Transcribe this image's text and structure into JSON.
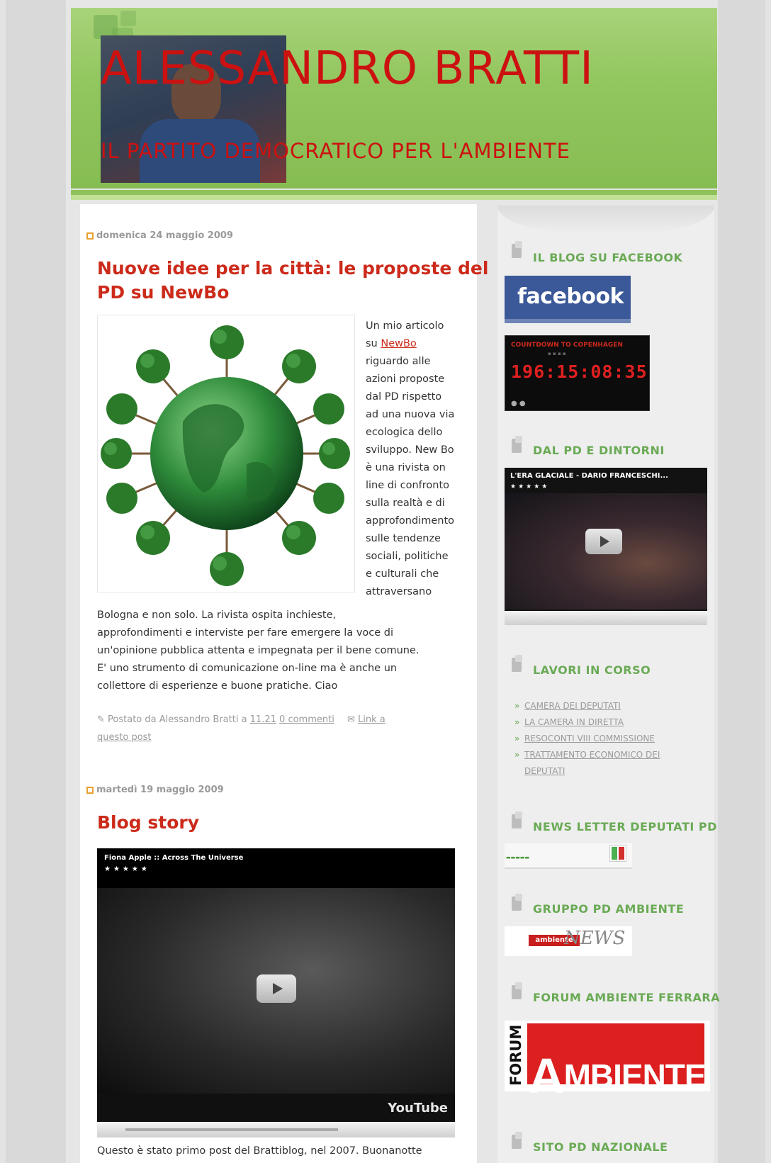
{
  "header": {
    "title": "ALESSANDRO BRATTI",
    "subtitle": "IL PARTITO DEMOCRATICO PER L'AMBIENTE"
  },
  "posts": [
    {
      "date": "domenica 24 maggio 2009",
      "title_line1": "Nuove idee per la città: le proposte del",
      "title_line2": "PD su NewBo",
      "wrap_text": [
        "Un mio articolo",
        "riguardo alle",
        "azioni proposte",
        "dal PD rispetto",
        "ad una nuova via",
        "ecologica dello",
        "sviluppo. New Bo",
        "è una rivista on",
        "line di confronto",
        "sulla realtà e di",
        "approfondimento",
        "sulle tendenze",
        "sociali, politiche",
        "e culturali che",
        "attraversano"
      ],
      "wrap_line2_prefix": "su ",
      "link_text": "NewBo",
      "full_text": [
        "Bologna e non solo. La rivista ospita inchieste,",
        "approfondimenti e interviste per fare emergere la voce di",
        "un'opinione pubblica attenta e impegnata per il bene comune.",
        "E' uno strumento di comunicazione on-line ma è anche un",
        "collettore di esperienze e buone pratiche. Ciao"
      ],
      "footer_posted": "Postato da Alessandro Bratti a",
      "footer_time": "11.21",
      "footer_comments": "0 commenti",
      "footer_link_line1": "Link a",
      "footer_link_line2": "questo post"
    },
    {
      "date": "martedì 19 maggio 2009",
      "title": "Blog story",
      "video_title": "Fiona Apple :: Across The Universe",
      "video_stars": "★★★★★",
      "youtube_label": "YouTube",
      "text": "Questo è stato primo post del Brattiblog, nel 2007. Buonanotte"
    }
  ],
  "sidebar": {
    "widgets": [
      {
        "title": "IL BLOG SU FACEBOOK"
      },
      {
        "title": "DAL PD E DINTORNI"
      },
      {
        "title": "LAVORI IN CORSO"
      },
      {
        "title": "NEWS LETTER DEPUTATI PD"
      },
      {
        "title": "GRUPPO PD AMBIENTE"
      },
      {
        "title": "FORUM AMBIENTE FERRARA"
      },
      {
        "title": "SITO PD NAZIONALE"
      }
    ],
    "facebook_label": "facebook",
    "countdown": {
      "label": "COUNTDOWN TO COPENHAGEN",
      "value": "196:15:08:35"
    },
    "side_video": {
      "title": "L'ERA GLACIALE - DARIO FRANCESCHI...",
      "stars": "★★★★★"
    },
    "links": [
      "CAMERA DEI DEPUTATI",
      "LA CAMERA IN DIRETTA",
      "RESOCONTI VIII COMMISSIONE",
      "TRATTAMENTO ECONOMICO DEI DEPUTATI"
    ],
    "ambiente_news": "ambiente",
    "ambiente_news_suffix": "NEWS",
    "forum_word": "FORUM",
    "ambiente_word": "MBIENTE",
    "ambiente_initial": "A"
  }
}
